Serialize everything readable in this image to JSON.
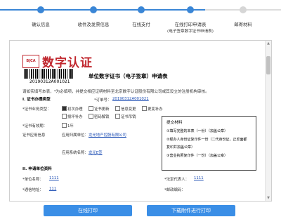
{
  "steps": [
    {
      "label": "确认信息",
      "state": "done"
    },
    {
      "label": "收件及发票信息",
      "state": "done"
    },
    {
      "label": "在线支付",
      "state": "done"
    },
    {
      "label": "在线打印申请表",
      "sublabel": "(电子签章数字证书申请表)",
      "state": "done"
    },
    {
      "label": "邮寄材料",
      "state": "todo"
    }
  ],
  "document": {
    "logo_badge": "BJCA",
    "logo_text": "数字认证",
    "barcode_number": "20190312A001021",
    "title": "单位数字证书（电子签章）申请表",
    "intro": "请如实填写本表，*为必填项，并提交相应证明材料至北京数字认证股份有限公司或其设立的注册机构审核。",
    "section1": "I. 证书办理类型",
    "order_label": "*订单号：",
    "order_value": "20190312A001021",
    "business_type_label": "*证书业务类型：",
    "business_options": [
      {
        "label": "初次办理",
        "checked": true
      },
      {
        "label": "证书更新",
        "checked": false
      },
      {
        "label": "信息变更",
        "checked": false
      },
      {
        "label": "更变补办",
        "checked": false
      },
      {
        "label": "损坏补办",
        "checked": false
      },
      {
        "label": "密码解锁",
        "checked": false
      },
      {
        "label": "证书吊销",
        "checked": false
      }
    ],
    "validity_label": "*证书有效期：",
    "validity_option": "1年",
    "app_label": "证书应用信息",
    "app_system_label": "应用归属单位：",
    "app_system_value": "龙光地产控股有限公司",
    "app_name_label": "应用系统名称：",
    "app_name_value": "龙光E签",
    "section2": "II. 申请单位资料",
    "unit_name_label": "*单位名称：",
    "unit_name_value": "1111",
    "legal_label": "*法定代表人：",
    "legal_value": "1111",
    "address_label": "*通信地址：",
    "address_value": "111",
    "postcode_label": "*邮政编码："
  },
  "note": {
    "title": "提交材料",
    "items": [
      "①填写完整的本表（一份）（加盖公章）",
      "②经办人身份证复印件一份（二代身份证，正反面都",
      "  复印并加盖公章）",
      "③营业执照复印件（一份）（加盖公章）"
    ]
  },
  "buttons": {
    "print_online": "在线打印",
    "download_print": "下载附件进行打印"
  }
}
